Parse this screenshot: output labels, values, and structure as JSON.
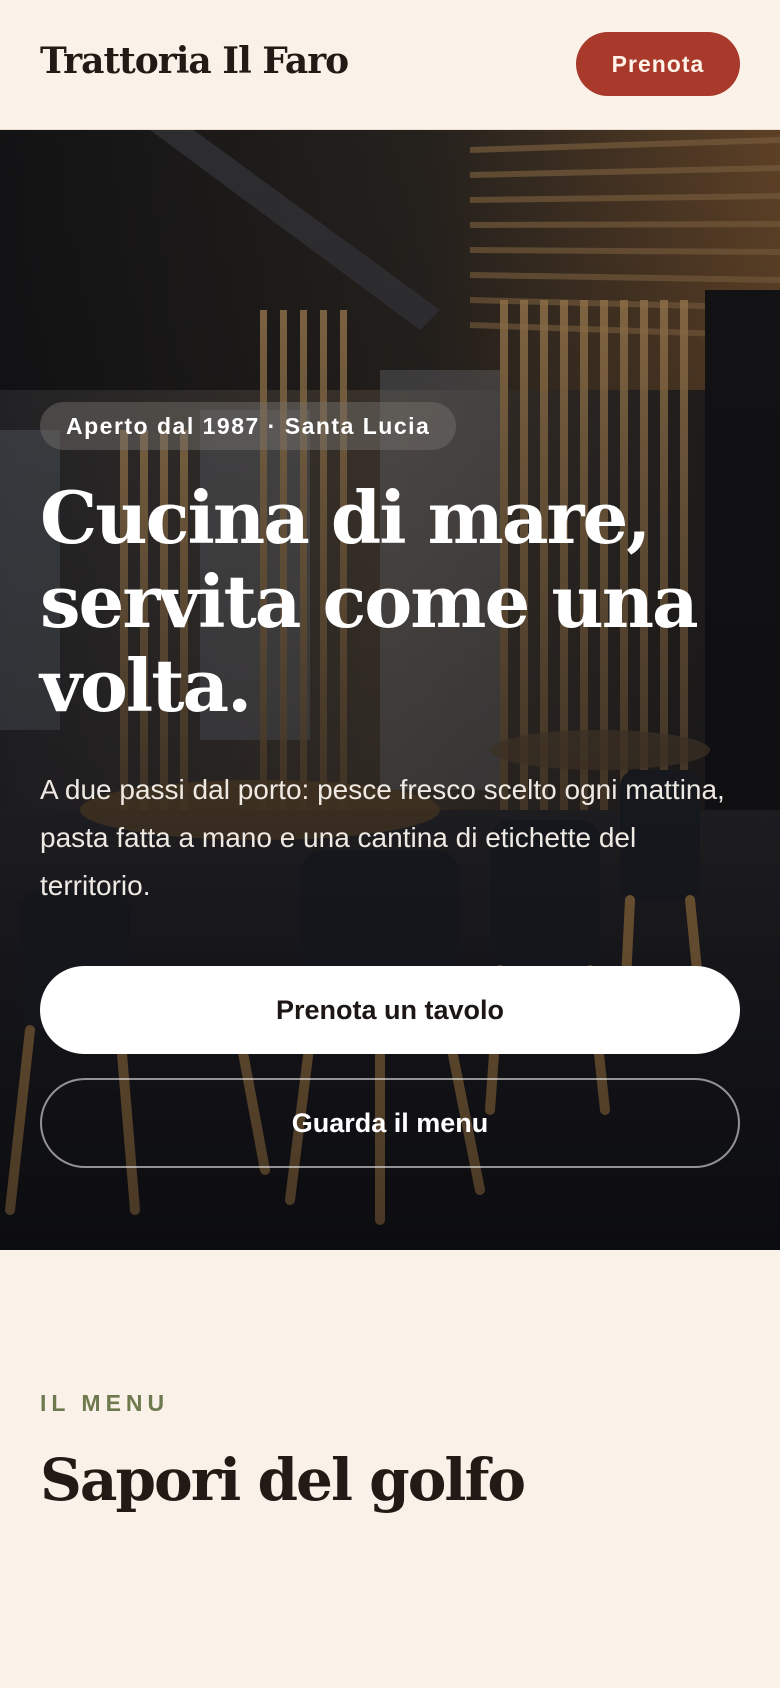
{
  "header": {
    "brand": "Trattoria Il Faro",
    "cta_label": "Prenota"
  },
  "hero": {
    "badge": "Aperto dal 1987 · Santa Lucia",
    "title": "Cucina di mare, servita come una volta.",
    "subtitle": "A due passi dal porto: pesce fresco scelto ogni mattina, pasta fatta a mano e una cantina di etichette del territorio.",
    "primary_cta": "Prenota un tavolo",
    "secondary_cta": "Guarda il menu",
    "image": "restaurant-interior-photo"
  },
  "menu_section": {
    "eyebrow": "IL MENU",
    "title": "Sapori del golfo"
  },
  "colors": {
    "background": "#FAF2E9",
    "accent": "#A93A2B",
    "eyebrow": "#6E7A4E",
    "ink": "#231A15"
  }
}
